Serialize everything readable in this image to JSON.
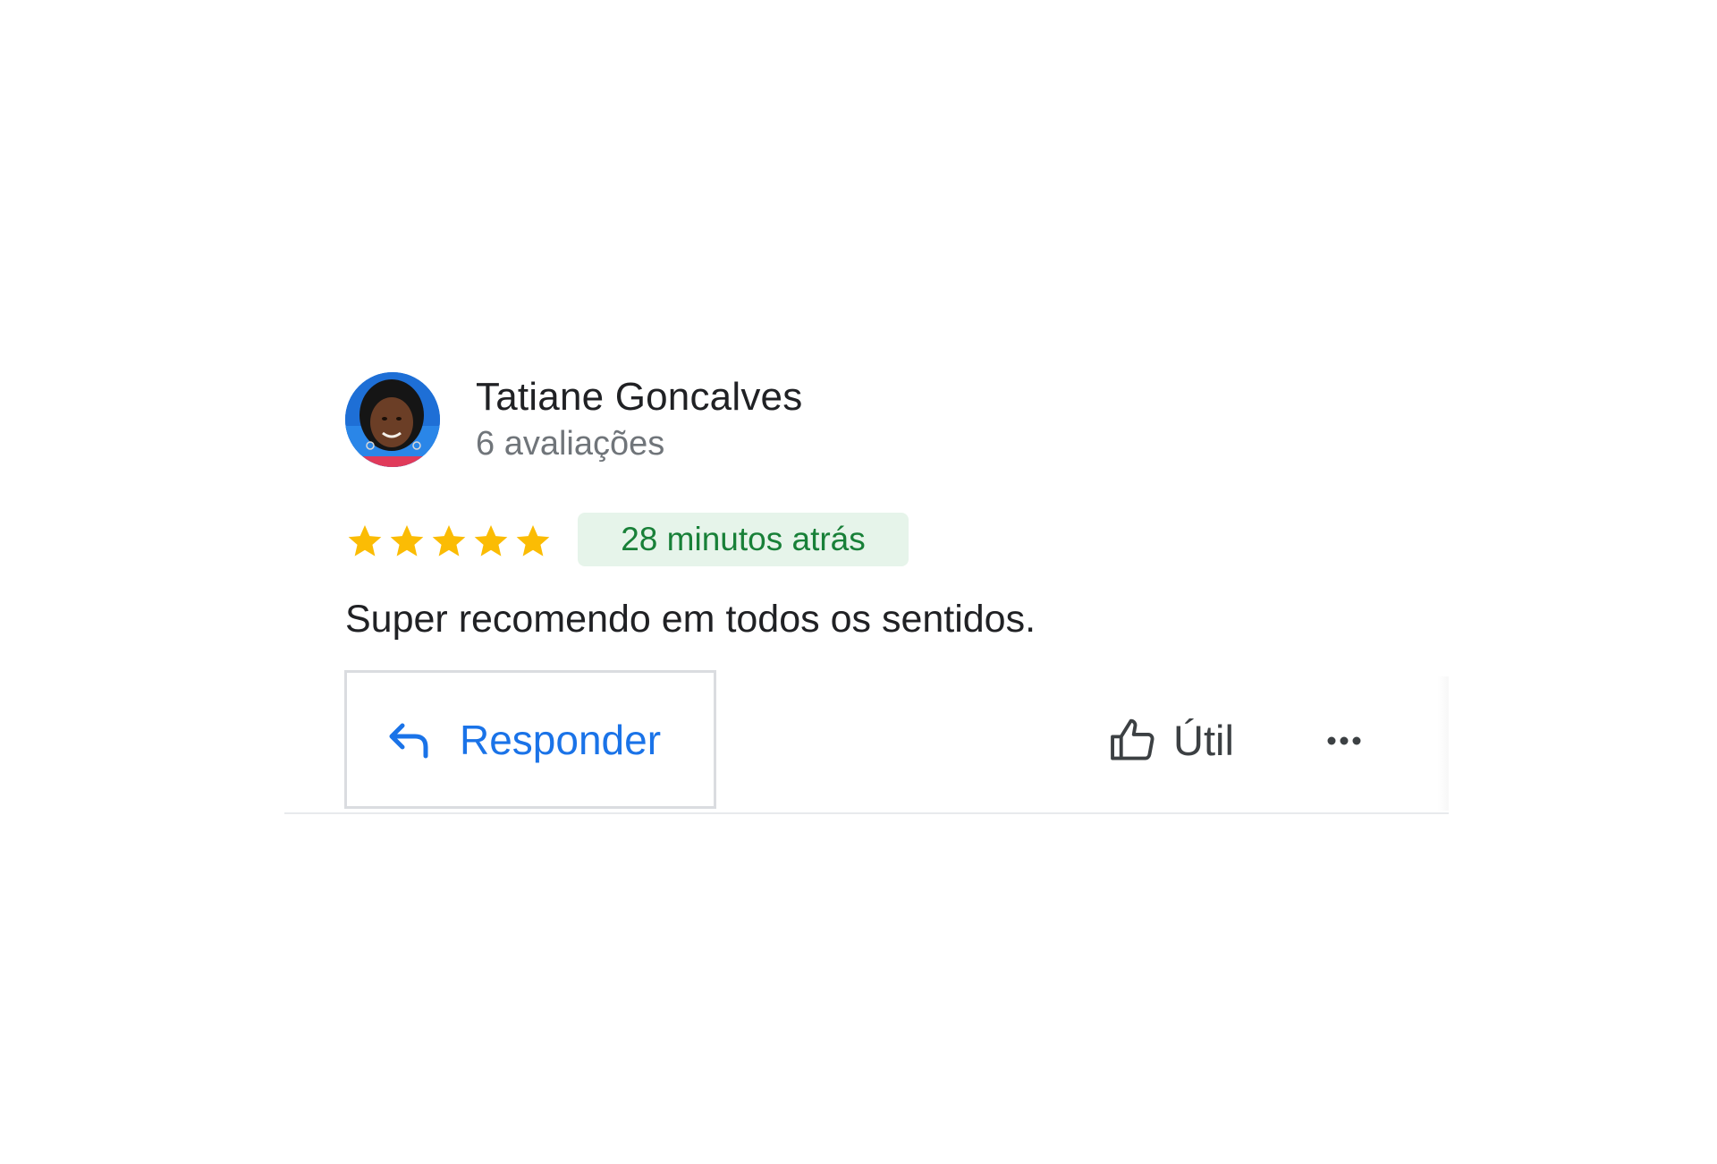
{
  "review": {
    "author": {
      "name": "Tatiane Goncalves",
      "review_count": "6 avaliações",
      "avatar_icon": "avatar-photo"
    },
    "rating": {
      "stars": 5,
      "max": 5,
      "star_color": "#fbbc04"
    },
    "time_ago": "28 minutos atrás",
    "text": "Super recomendo em todos os sentidos.",
    "actions": {
      "reply_label": "Responder",
      "reply_icon": "reply-arrow-icon",
      "helpful_label": "Útil",
      "helpful_icon": "thumbs-up-icon",
      "more_icon": "more-horizontal-icon"
    }
  },
  "colors": {
    "accent_blue": "#1a73e8",
    "badge_bg": "#e6f4ea",
    "badge_text": "#188038",
    "secondary_text": "#70757a"
  }
}
